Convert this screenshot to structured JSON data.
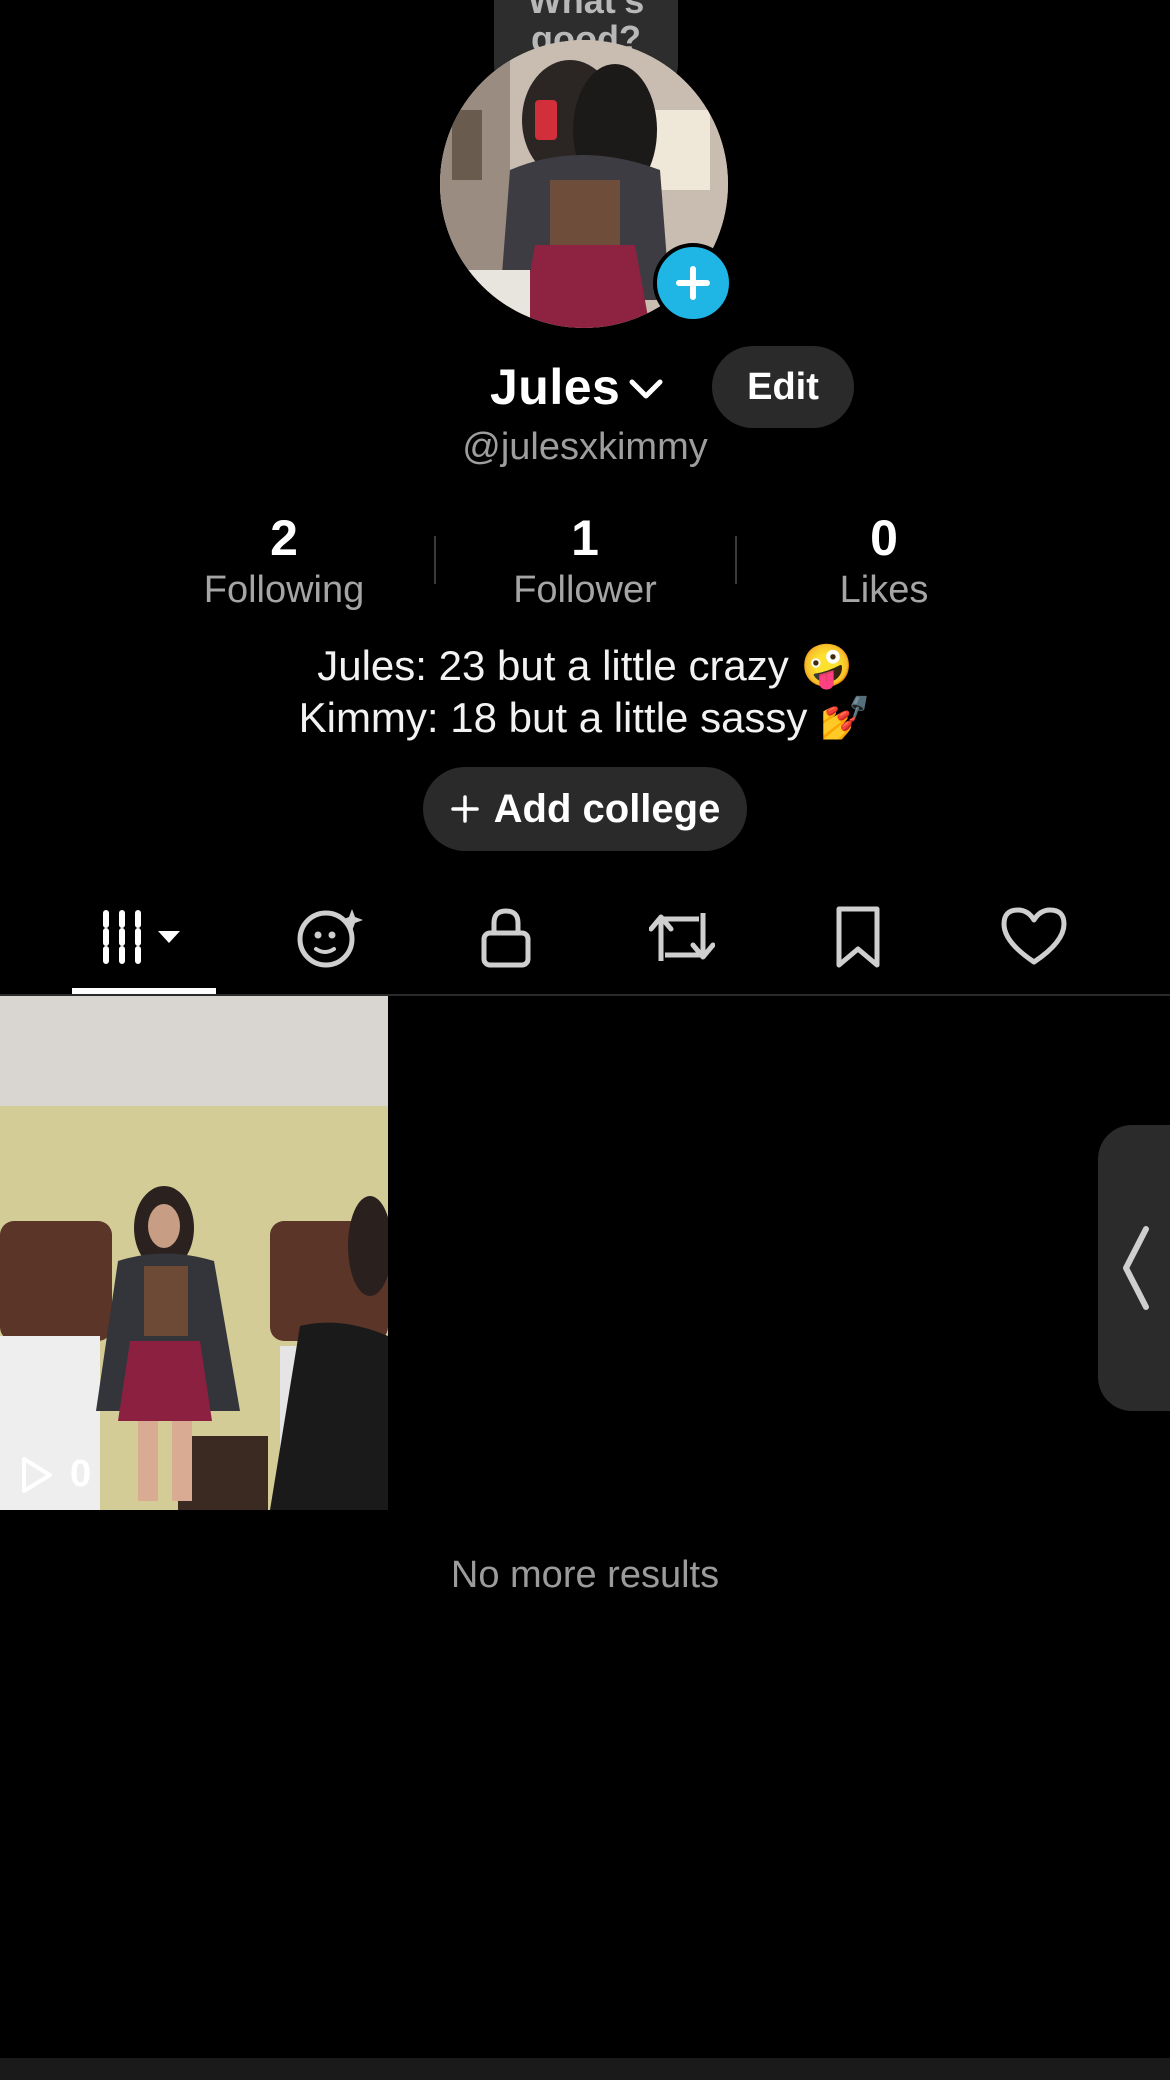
{
  "prompt_bubble": {
    "line1": "What's",
    "line2": "good?"
  },
  "profile": {
    "display_name": "Jules",
    "username": "@julesxkimmy",
    "edit_label": "Edit"
  },
  "stats": [
    {
      "value": "2",
      "label": "Following"
    },
    {
      "value": "1",
      "label": "Follower"
    },
    {
      "value": "0",
      "label": "Likes"
    }
  ],
  "bio": {
    "line1": "Jules: 23 but a little crazy 🤪",
    "line2": "Kimmy: 18 but a little sassy 💅"
  },
  "add_college": {
    "icon": "plus-icon",
    "label": "Add college"
  },
  "tabs": [
    {
      "icon": "videos-grid-icon",
      "active": true
    },
    {
      "icon": "ai-face-icon",
      "active": false
    },
    {
      "icon": "lock-icon",
      "active": false
    },
    {
      "icon": "repost-icon",
      "active": false
    },
    {
      "icon": "bookmark-icon",
      "active": false
    },
    {
      "icon": "heart-icon",
      "active": false
    }
  ],
  "videos": [
    {
      "play_count": "0"
    }
  ],
  "no_more_results": "No more results",
  "colors": {
    "background": "#000000",
    "accent_blue": "#1fb6e6",
    "pill_bg": "#2a2a2a",
    "muted_text": "#9e9e9e"
  }
}
